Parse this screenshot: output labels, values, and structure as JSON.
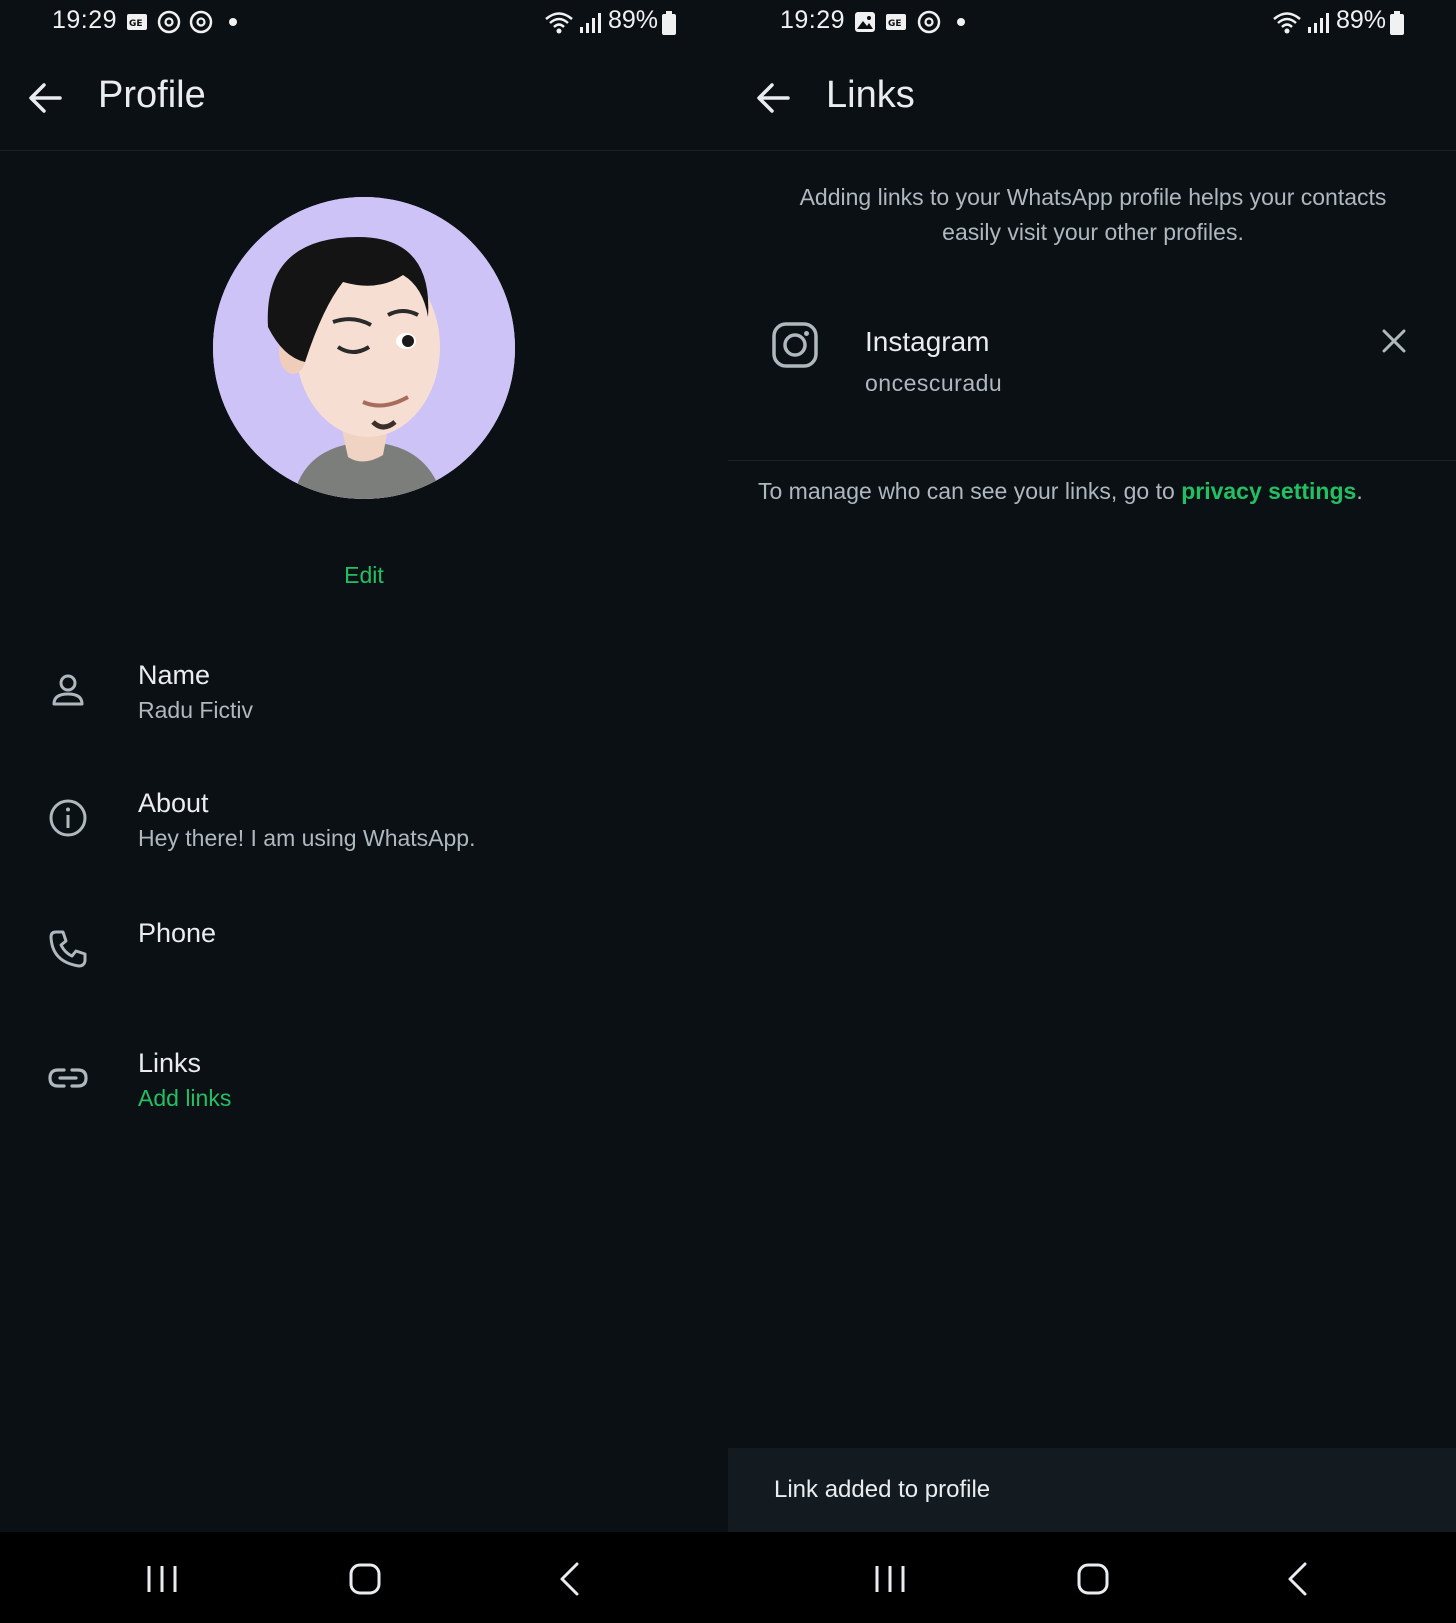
{
  "left": {
    "status": {
      "time": "19:29",
      "battery": "89%",
      "icons": [
        "gallery-news-icon",
        "threads-icon",
        "threads-icon",
        "dot-icon",
        "wifi-icon",
        "signal-icon",
        "battery-icon"
      ]
    },
    "toolbar": {
      "title": "Profile",
      "back_icon": "arrow-left-icon"
    },
    "avatar": {
      "bg_color": "#cec3f7"
    },
    "edit_label": "Edit",
    "rows": [
      {
        "icon": "person-icon",
        "label": "Name",
        "value": "Radu Fictiv"
      },
      {
        "icon": "info-icon",
        "label": "About",
        "value": "Hey there! I am using WhatsApp."
      },
      {
        "icon": "phone-icon",
        "label": "Phone",
        "value": ""
      },
      {
        "icon": "link-icon",
        "label": "Links",
        "value": "Add links"
      }
    ]
  },
  "right": {
    "status": {
      "time": "19:29",
      "battery": "89%",
      "icons": [
        "image-icon",
        "gallery-news-icon",
        "threads-icon",
        "dot-icon",
        "wifi-icon",
        "signal-icon",
        "battery-icon"
      ]
    },
    "toolbar": {
      "title": "Links",
      "back_icon": "arrow-left-icon"
    },
    "intro": "Adding links to your WhatsApp profile helps your contacts easily visit your other profiles.",
    "link": {
      "icon": "instagram-icon",
      "title": "Instagram",
      "username": "oncescuradu",
      "remove_icon": "close-icon"
    },
    "manage_prefix": "To manage who can see your links, go to ",
    "manage_link": "privacy settings",
    "manage_suffix": ".",
    "snackbar": "Link added to profile"
  },
  "navbar": {
    "icons": [
      "recents-icon",
      "home-icon",
      "back-icon"
    ]
  },
  "colors": {
    "background": "#0b1014",
    "accent": "#21c063",
    "text": "#e9edef",
    "secondary": "#aeb8bd"
  }
}
